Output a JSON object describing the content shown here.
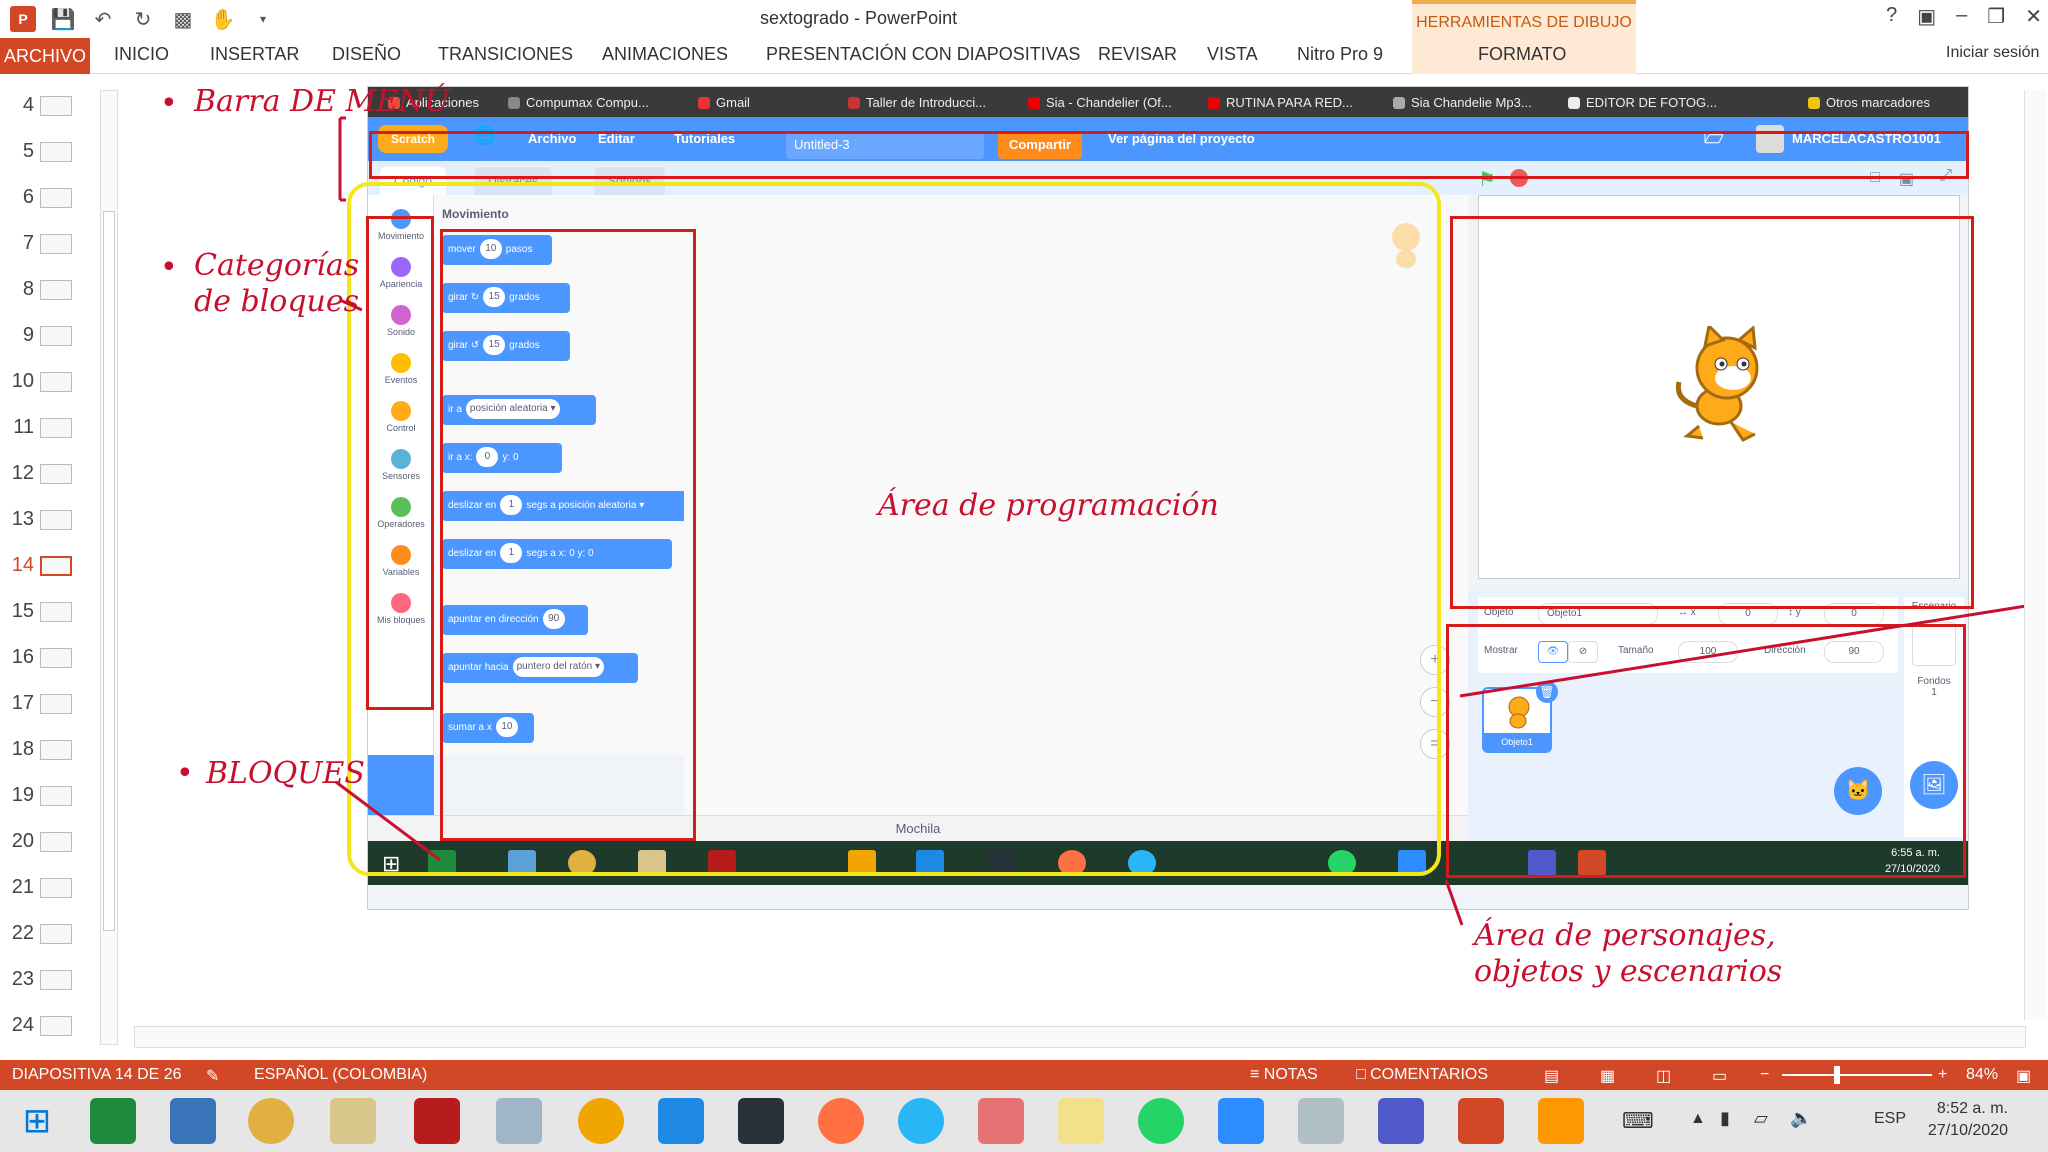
{
  "window": {
    "title": "sextogrado - PowerPoint",
    "context_tab": "HERRAMIENTAS DE DIBUJO",
    "help": "?",
    "signin": "Iniciar sesión"
  },
  "ribbon": {
    "file_tab": "ARCHIVO",
    "tabs": [
      "INICIO",
      "INSERTAR",
      "DISEÑO",
      "TRANSICIONES",
      "ANIMACIONES",
      "PRESENTACIÓN CON DIAPOSITIVAS",
      "REVISAR",
      "VISTA",
      "Nitro Pro 9",
      "FORMATO"
    ]
  },
  "slides": {
    "numbers": [
      "4",
      "5",
      "6",
      "7",
      "8",
      "9",
      "10",
      "11",
      "12",
      "13",
      "14",
      "15",
      "16",
      "17",
      "18",
      "19",
      "20",
      "21",
      "22",
      "23",
      "24"
    ],
    "active": "14"
  },
  "screenshot": {
    "bookmarks": [
      "Aplicaciones",
      "Compumax Compu...",
      "Gmail",
      "Taller de Introducci...",
      "Sia - Chandelier (Of...",
      "RUTINA PARA RED...",
      "Sia Chandelie Mp3...",
      "EDITOR DE FOTOG...",
      "Otros marcadores"
    ],
    "scratch_menu": {
      "logo": "Scratch",
      "archivo": "Archivo",
      "editar": "Editar",
      "tutoriales": "Tutoriales",
      "project": "Untitled-3",
      "share": "Compartir",
      "view_page": "Ver página del proyecto",
      "user": "MARCELACASTRO1001"
    },
    "tabs": [
      "Código",
      "Disfraces",
      "Sonidos"
    ],
    "categories": [
      {
        "name": "Movimiento",
        "color": "#4c97ff"
      },
      {
        "name": "Apariencia",
        "color": "#9966ff"
      },
      {
        "name": "Sonido",
        "color": "#cf63cf"
      },
      {
        "name": "Eventos",
        "color": "#ffbf00"
      },
      {
        "name": "Control",
        "color": "#ffab19"
      },
      {
        "name": "Sensores",
        "color": "#5cb1d6"
      },
      {
        "name": "Operadores",
        "color": "#59c059"
      },
      {
        "name": "Variables",
        "color": "#ff8c1a"
      },
      {
        "name": "Mis bloques",
        "color": "#ff6680"
      }
    ],
    "palette_title": "Movimiento",
    "blocks": [
      {
        "a": "mover",
        "v": "10",
        "b": "pasos"
      },
      {
        "a": "girar ↻",
        "v": "15",
        "b": "grados"
      },
      {
        "a": "girar ↺",
        "v": "15",
        "b": "grados"
      },
      {
        "a": "ir a",
        "v": "posición aleatoria ▾",
        "b": ""
      },
      {
        "a": "ir a x:",
        "v": "0",
        "b": "y: 0"
      },
      {
        "a": "deslizar en",
        "v": "1",
        "b": "segs a posición aleatoria ▾"
      },
      {
        "a": "deslizar en",
        "v": "1",
        "b": "segs a x: 0 y: 0"
      },
      {
        "a": "apuntar en dirección",
        "v": "90",
        "b": ""
      },
      {
        "a": "apuntar hacia",
        "v": "puntero del ratón ▾",
        "b": ""
      },
      {
        "a": "sumar a x",
        "v": "10",
        "b": ""
      }
    ],
    "mochila": "Mochila",
    "sprite_info": {
      "objeto_label": "Objeto",
      "objeto": "Objeto1",
      "x": "0",
      "y": "0",
      "mostrar": "Mostrar",
      "tamano_label": "Tamaño",
      "tamano": "100",
      "direccion_label": "Dirección",
      "direccion": "90"
    },
    "sprite_tile": "Objeto1",
    "stage_col": {
      "title": "Escenario",
      "fondos": "Fondos",
      "count": "1"
    },
    "inner_clock": {
      "time": "6:55 a. m.",
      "date": "27/10/2020"
    }
  },
  "annotations": {
    "barra": "Barra DE MENÚ",
    "categorias1": "Categorías",
    "categorias2": "de bloques",
    "bloques": "BLOQUES",
    "area_prog": "Área de programación",
    "area_pers1": "Área de personajes,",
    "area_pers2": "objetos y escenarios"
  },
  "statusbar": {
    "slide": "DIAPOSITIVA 14 DE 26",
    "language": "ESPAÑOL (COLOMBIA)",
    "notes": "NOTAS",
    "comments": "COMENTARIOS",
    "zoom": "84%"
  },
  "taskbar": {
    "lang": "ESP",
    "time": "8:52 a. m.",
    "date": "27/10/2020"
  },
  "colors": {
    "accent": "#d24726",
    "annotation": "#c8102e",
    "yellow": "#f5e61b",
    "scratch_blue": "#4c97ff"
  }
}
